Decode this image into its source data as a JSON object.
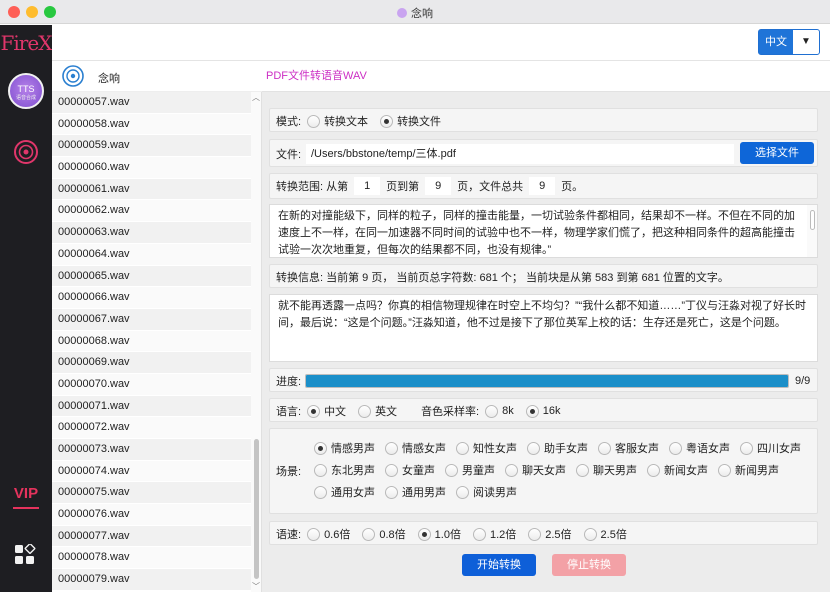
{
  "window": {
    "title": "念响"
  },
  "header": {
    "language_value": "中文"
  },
  "rail": {
    "logo": "FireX",
    "tts_label": "TTS",
    "tts_sub": "语音合成",
    "vip_label": "VIP"
  },
  "filelist": {
    "title": "念响",
    "files": [
      "00000057.wav",
      "00000058.wav",
      "00000059.wav",
      "00000060.wav",
      "00000061.wav",
      "00000062.wav",
      "00000063.wav",
      "00000064.wav",
      "00000065.wav",
      "00000066.wav",
      "00000067.wav",
      "00000068.wav",
      "00000069.wav",
      "00000070.wav",
      "00000071.wav",
      "00000072.wav",
      "00000073.wav",
      "00000074.wav",
      "00000075.wav",
      "00000076.wav",
      "00000077.wav",
      "00000078.wav",
      "00000079.wav"
    ]
  },
  "main": {
    "page_title": "PDF文件转语音WAV",
    "mode": {
      "label": "模式:",
      "options": [
        "转换文本",
        "转换文件"
      ],
      "selected": 1
    },
    "file": {
      "label": "文件:",
      "path": "/Users/bbstone/temp/三体.pdf",
      "choose_button": "选择文件"
    },
    "range": {
      "label_prefix": "转换范围: 从第",
      "from": "1",
      "mid": "页到第",
      "to": "9",
      "total_label": "页，文件总共",
      "total": "9",
      "suffix": "页。"
    },
    "preview_text": "在新的对撞能级下，同样的粒子，同样的撞击能量，一切试验条件都相同，结果却不一样。不但在不同的加速度上不一样，在同一加速器不同时间的试验中也不一样，物理学家们慌了，把这种相同条件的超高能撞击试验一次次地重复，但每次的结果都不同，也没有规律。”",
    "info": "转换信息: 当前第 9 页， 当前页总字符数: 681 个； 当前块是从第 583 到第 681 位置的文字。",
    "current_text": "就不能再透露一点吗？你真的相信物理规律在时空上不均匀？”“我什么都不知道……”丁仪与汪淼对视了好长时间，最后说：“这是个问题。”汪淼知道，他不过是接下了那位英军上校的话：生存还是死亡，这是个问题。",
    "progress": {
      "label": "进度:",
      "value": 1.0,
      "text": "9/9"
    },
    "language": {
      "label": "语言:",
      "options": [
        "中文",
        "英文"
      ],
      "selected": 0
    },
    "sample_rate": {
      "label": "音色采样率:",
      "options": [
        "8k",
        "16k"
      ],
      "selected": 1
    },
    "scene": {
      "label": "场景:",
      "options": [
        "情感男声",
        "情感女声",
        "知性女声",
        "助手女声",
        "客服女声",
        "粤语女声",
        "四川女声",
        "东北男声",
        "女童声",
        "男童声",
        "聊天女声",
        "聊天男声",
        "新闻女声",
        "新闻男声",
        "通用女声",
        "通用男声",
        "阅读男声"
      ],
      "selected": 0
    },
    "speed": {
      "label": "语速:",
      "options": [
        "0.6倍",
        "0.8倍",
        "1.0倍",
        "1.2倍",
        "2.5倍",
        "2.5倍"
      ],
      "selected": 2
    },
    "start_button": "开始转换",
    "stop_button": "停止转换"
  }
}
